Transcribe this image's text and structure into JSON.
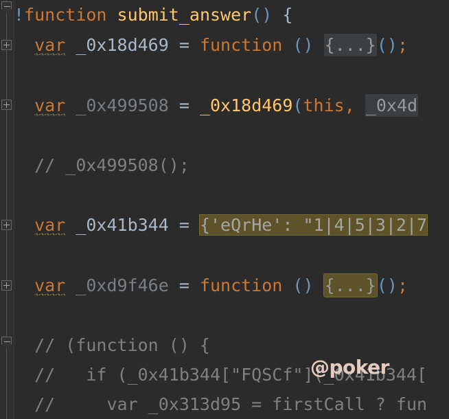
{
  "theme": {
    "background": "#2b2b2b",
    "gutter_background": "#2f2f2f",
    "keyword_color": "#cc7832",
    "function_name_color": "#ffc66d",
    "identifier_color": "#a9b7c6",
    "dimmed_identifier_color": "#7a7f85",
    "paren_color": "#6897bb",
    "comment_color": "#808080",
    "search_highlight_color": "#5d5228",
    "fold_badge_color": "#3c3f41",
    "watermark_color": "#f2d8cc"
  },
  "watermark": {
    "text": "@poker"
  },
  "gutter": {
    "markers": [
      {
        "type": "collapse-fold-marker",
        "icon": "minus-icon",
        "line": 1
      },
      {
        "type": "expand-fold-marker",
        "icon": "plus-icon",
        "line": 2
      },
      {
        "type": "expand-fold-marker",
        "icon": "plus-icon",
        "line": 3
      },
      {
        "type": "expand-fold-marker",
        "icon": "plus-icon",
        "line": 5
      },
      {
        "type": "expand-fold-marker",
        "icon": "plus-icon",
        "line": 6
      },
      {
        "type": "collapse-fold-marker",
        "icon": "minus-icon",
        "line": 8
      }
    ]
  },
  "code": {
    "line1": {
      "bang": "!",
      "kw_function": "function",
      "space": " ",
      "fn_name": "submit_answer",
      "parens": "()",
      "open_brace": " {"
    },
    "line2": {
      "indent": "  ",
      "kw_var": "var",
      "name": " _0x18d469",
      "eq": " = ",
      "kw_function": "function",
      "parens": " () ",
      "fold": "{...}",
      "call": "()",
      "semi": ";"
    },
    "line3": {
      "indent": "  ",
      "kw_var": "var",
      "name": " _0x499508",
      "eq": " = ",
      "callee": "_0x18d469",
      "open_paren": "(",
      "kw_this": "this",
      "comma": ", ",
      "arg_truncated": "_0x4d"
    },
    "line4": {
      "indent": "  ",
      "comment": "// _0x499508();"
    },
    "line5": {
      "indent": "  ",
      "kw_var": "var",
      "name": " _0x41b344",
      "eq": " = ",
      "highlighted_truncated": "{'eQrHe': \"1|4|5|3|2|7"
    },
    "line6": {
      "indent": "  ",
      "kw_var": "var",
      "name": " _0xd9f46e",
      "eq": " = ",
      "kw_function": "function",
      "parens": " () ",
      "fold": "{...}",
      "call": "()",
      "semi": ";"
    },
    "line7": {
      "indent": "  ",
      "comment": "// (function () {"
    },
    "line8": {
      "indent": "  ",
      "comment": "//   if (_0x41b344[\"FQSCf\"](_0x41b344["
    },
    "line9": {
      "indent": "  ",
      "comment": "//     var _0x313d95 = firstCall ? fun"
    }
  }
}
